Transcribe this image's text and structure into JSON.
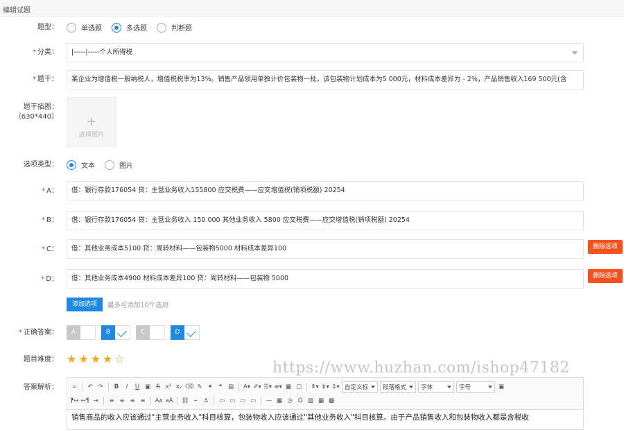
{
  "header": {
    "title": "编辑试题"
  },
  "form": {
    "type": {
      "label": "题型：",
      "options": [
        "单选题",
        "多选题",
        "判断题"
      ],
      "selected": 1
    },
    "category": {
      "label": "分类：",
      "value": "|-----|-----个人所得税"
    },
    "stem": {
      "label": "题干：",
      "value": "某企业为增值税一般纳税人，增值税税率为13%。销售产品领用单独计价包装物一批，该包装物计划成本为5 000元，材料成本差异为 - 2%，产品销售收入169 500元(含"
    },
    "stem_image": {
      "label_line1": "题干插图：",
      "label_line2": "（630*440）",
      "upload_text": "选择图片",
      "plus": "+"
    },
    "option_type": {
      "label": "选项类型：",
      "options": [
        "文本",
        "图片"
      ],
      "selected": 0
    },
    "options": [
      {
        "label": "A：",
        "value": "借：银行存款176054 贷：主营业务收入155800 应交税费——应交增值税(销项税额) 20254"
      },
      {
        "label": "B：",
        "value": "借：银行存款176054 贷：主营业务收入 150 000 其他业务收入 5800 应交税费——应交增值税(销项税额) 20254"
      },
      {
        "label": "C：",
        "value": "借：其他业务成本5100 贷：周转材料——包装物5000 材料成本差异100",
        "delete_label": "删除选项"
      },
      {
        "label": "D：",
        "value": "借：其他业务成本4900 材料成本差异100 贷：周转材料——包装物 5000",
        "delete_label": "删除选项"
      }
    ],
    "add_option": {
      "button": "添加选项",
      "hint": "最多可添加10个选项"
    },
    "correct_answer": {
      "label": "正确答案：",
      "items": [
        {
          "letter": "A",
          "checked": false
        },
        {
          "letter": "B",
          "checked": true
        },
        {
          "letter": "C",
          "checked": false
        },
        {
          "letter": "D",
          "checked": true
        }
      ]
    },
    "difficulty": {
      "label": "题目难度：",
      "rating": 4,
      "max": 5
    },
    "analysis": {
      "label": "答案解析：",
      "toolbar": {
        "custom_title": "自定义标",
        "paragraph": "段落格式",
        "font": "字体",
        "size": "字号"
      },
      "content": "销售商品的收入应该通过\"主营业务收入\"科目核算，包装物收入应该通过\"其他业务收入\"科目核算。由于产品销售收入和包装物收入都是含税收"
    }
  },
  "watermark": "https://www.huzhan.com/ishop47182",
  "colors": {
    "primary": "#1e88e5",
    "danger": "#f4511e",
    "disabled": "#c8c8c8",
    "star": "#f0a81f"
  }
}
